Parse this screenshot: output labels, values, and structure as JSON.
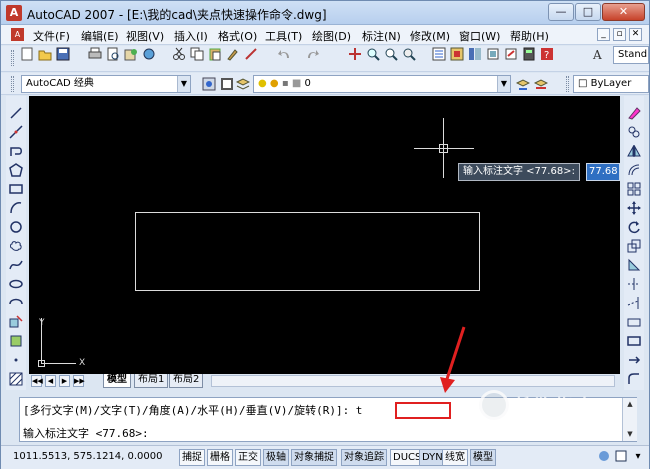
{
  "window": {
    "title": "AutoCAD 2007 - [E:\\我的cad\\夹点快速操作命令.dwg]",
    "logo": "A",
    "min_glyph": "—",
    "max_glyph": "□",
    "close_glyph": "✕"
  },
  "menubar": {
    "doc_icon": "A",
    "items": [
      {
        "label": "文件(F)",
        "icon": "document-icon"
      },
      {
        "label": "编辑(E)"
      },
      {
        "label": "视图(V)"
      },
      {
        "label": "插入(I)"
      },
      {
        "label": "格式(O)"
      },
      {
        "label": "工具(T)"
      },
      {
        "label": "绘图(D)"
      },
      {
        "label": "标注(N)"
      },
      {
        "label": "修改(M)"
      },
      {
        "label": "窗口(W)"
      },
      {
        "label": "帮助(H)"
      }
    ],
    "mdi_min": "_",
    "mdi_restore": "▫",
    "mdi_close": "✕"
  },
  "toolbar1": {
    "text_style": "Stand"
  },
  "toolbar2": {
    "workspace": "AutoCAD 经典",
    "layer": "0",
    "linetype": "ByLayer"
  },
  "canvas": {
    "tooltip_prompt": "输入标注文字 <77.68>:",
    "dyn_value": "77.68",
    "ucs_x": "X",
    "ucs_y": "Y"
  },
  "tabs": {
    "model": "模型",
    "layout1": "布局1",
    "layout2": "布局2"
  },
  "command": {
    "line1": "[多行文字(M)/文字(T)/角度(A)/水平(H)/垂直(V)/旋转(R)]: t",
    "line2": "输入标注文字 <77.68>:"
  },
  "statusbar": {
    "coords": "1011.5513, 575.1214, 0.0000",
    "buttons": [
      "捕捉",
      "栅格",
      "正交",
      "极轴",
      "对象捕捉",
      "对象追踪",
      "DUCS",
      "DYN",
      "线宽",
      "模型"
    ]
  },
  "watermark": {
    "text": "搜狗指南",
    "url": "zhinan.sogou.com"
  },
  "colors": {
    "canvas_bg": "#000000",
    "ui_bg": "#dce6f2",
    "annotation_red": "#e02020",
    "dyn_input_bg": "#2f6fc2"
  }
}
